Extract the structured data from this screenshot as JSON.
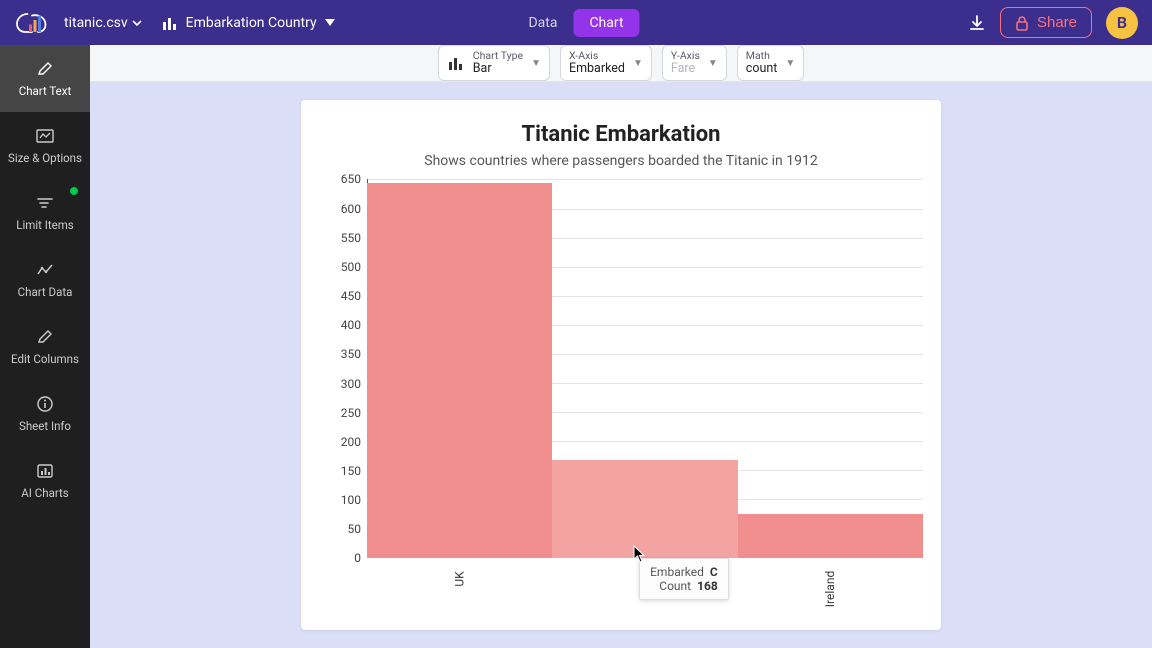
{
  "header": {
    "filename": "titanic.csv",
    "chart_name": "Embarkation Country",
    "tabs": {
      "data": "Data",
      "chart": "Chart"
    },
    "share": "Share",
    "avatar_initial": "B"
  },
  "sidebar": {
    "chart_text": "Chart Text",
    "size_options": "Size & Options",
    "limit_items": "Limit Items",
    "chart_data": "Chart Data",
    "edit_columns": "Edit Columns",
    "sheet_info": "Sheet Info",
    "ai_charts": "AI Charts"
  },
  "config": {
    "chart_type": {
      "label": "Chart Type",
      "value": "Bar"
    },
    "x_axis": {
      "label": "X-Axis",
      "value": "Embarked"
    },
    "y_axis": {
      "label": "Y-Axis",
      "placeholder": "Fare"
    },
    "math": {
      "label": "Math",
      "value": "count"
    }
  },
  "chart": {
    "title": "Titanic Embarkation",
    "subtitle": "Shows countries where passengers boarded the Titanic in 1912"
  },
  "chart_data": {
    "type": "bar",
    "title": "Titanic Embarkation",
    "subtitle": "Shows countries where passengers boarded the Titanic in 1912",
    "xlabel": "",
    "ylabel": "",
    "categories": [
      "UK",
      "",
      "Ireland"
    ],
    "values": [
      644,
      168,
      77
    ],
    "ylim": [
      0,
      650
    ],
    "ytick_step": 50
  },
  "tooltip": {
    "k1": "Embarked",
    "v1": "C",
    "k2": "Count",
    "v2": "168"
  }
}
